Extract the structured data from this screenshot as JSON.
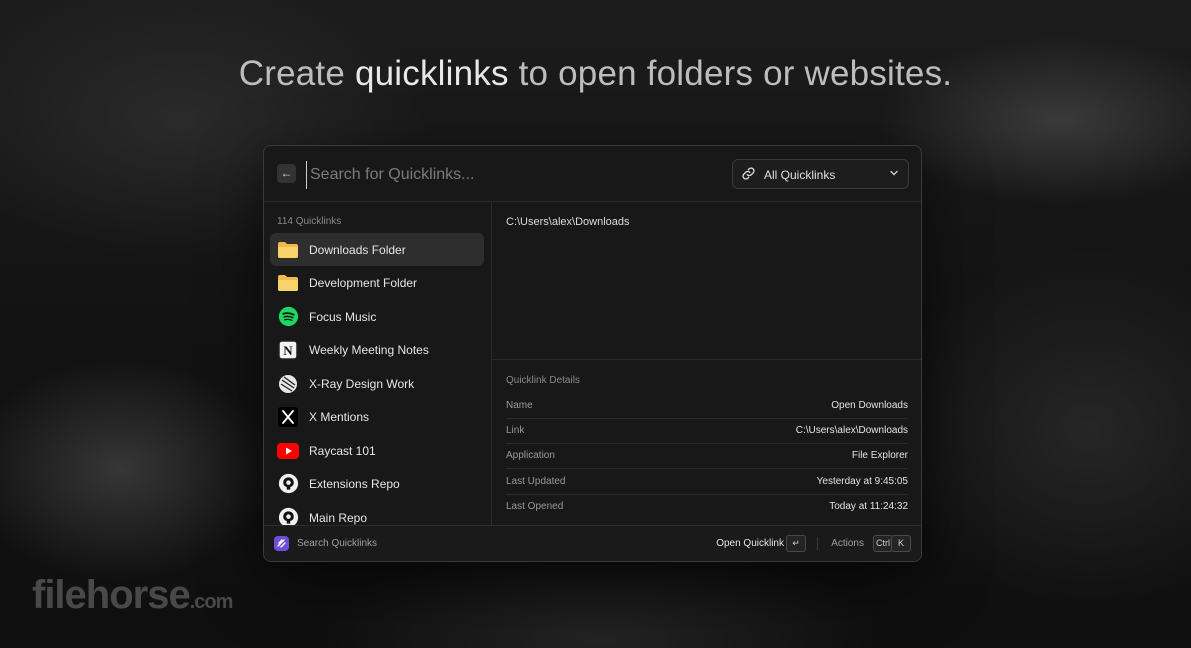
{
  "headline": {
    "part1": "Create ",
    "bold": "quicklinks",
    "part2": " to open folders or websites."
  },
  "search": {
    "placeholder": "Search for Quicklinks...",
    "value": ""
  },
  "filter": {
    "label": "All Quicklinks",
    "icon": "link-icon"
  },
  "list": {
    "header": "114 Quicklinks",
    "items": [
      {
        "label": "Downloads Folder",
        "icon": "folder-icon",
        "selected": true
      },
      {
        "label": "Development Folder",
        "icon": "folder-icon"
      },
      {
        "label": "Focus Music",
        "icon": "spotify-icon"
      },
      {
        "label": "Weekly Meeting Notes",
        "icon": "notion-icon"
      },
      {
        "label": "X-Ray Design Work",
        "icon": "xray-icon"
      },
      {
        "label": "X Mentions",
        "icon": "x-icon"
      },
      {
        "label": "Raycast 101",
        "icon": "youtube-icon"
      },
      {
        "label": "Extensions Repo",
        "icon": "github-icon"
      },
      {
        "label": "Main Repo",
        "icon": "github-icon"
      }
    ]
  },
  "detail": {
    "path": "C:\\Users\\alex\\Downloads",
    "section_title": "Quicklink Details",
    "rows": [
      {
        "key": "Name",
        "value": "Open Downloads"
      },
      {
        "key": "Link",
        "value": "C:\\Users\\alex\\Downloads"
      },
      {
        "key": "Application",
        "value": "File Explorer"
      },
      {
        "key": "Last Updated",
        "value": "Yesterday at 9:45:05"
      },
      {
        "key": "Last Opened",
        "value": "Today at 11:24:32"
      }
    ]
  },
  "footer": {
    "label": "Search Quicklinks",
    "primary_action": "Open Quicklink",
    "enter_key": "↵",
    "actions_label": "Actions",
    "ctrl_key": "Ctrl",
    "k_key": "K"
  },
  "watermark": {
    "main": "filehorse",
    "domain": ".com"
  },
  "colors": {
    "accent": "#6b4fd8",
    "folder": "#f5c451",
    "spotify": "#1ed760",
    "youtube": "#ff0000"
  }
}
